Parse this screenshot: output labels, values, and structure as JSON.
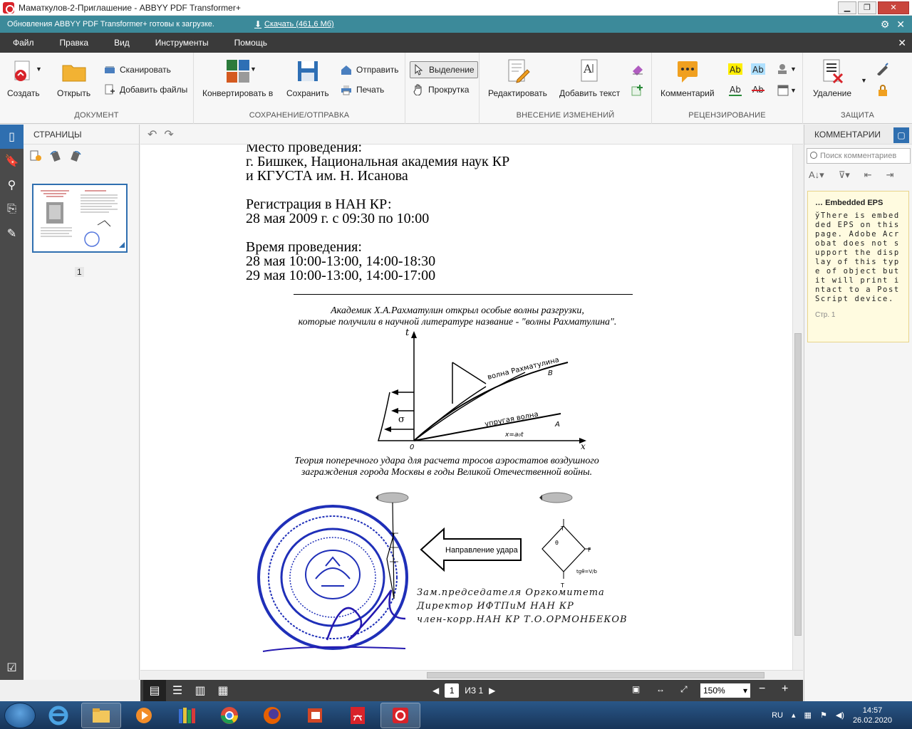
{
  "window": {
    "title": "Маматкулов-2-Приглашение - ABBYY PDF Transformer+"
  },
  "update_bar": {
    "message": "Обновления ABBYY PDF Transformer+ готовы к загрузке.",
    "download_label": "Скачать (461,6 Мб)"
  },
  "menu": [
    "Файл",
    "Правка",
    "Вид",
    "Инструменты",
    "Помощь"
  ],
  "ribbon": {
    "document": {
      "title": "ДОКУМЕНТ",
      "create": "Создать",
      "open": "Открыть",
      "scan": "Сканировать",
      "add_files": "Добавить файлы"
    },
    "save": {
      "title": "СОХРАНЕНИЕ/ОТПРАВКА",
      "convert": "Конвертировать в",
      "save": "Сохранить",
      "send": "Отправить",
      "print": "Печать",
      "select": "Выделение",
      "scroll": "Прокрутка"
    },
    "edit": {
      "title": "ВНЕСЕНИЕ ИЗМЕНЕНИЙ",
      "edit": "Редактировать",
      "add_text": "Добавить текст"
    },
    "review": {
      "title": "РЕЦЕНЗИРОВАНИЕ",
      "comment": "Комментарий"
    },
    "protect": {
      "title": "ЗАЩИТА",
      "delete": "Удаление"
    }
  },
  "pages_panel": {
    "title": "СТРАНИЦЫ",
    "page_number": "1"
  },
  "document": {
    "lines": [
      "Место проведения:",
      "г. Бишкек, Национальная академия наук КР",
      "и КГУСТА им. Н. Исанова",
      "Регистрация в НАН КР:",
      "28 мая 2009 г.  с 09:30 по 10:00",
      "Время проведения:",
      "28 мая 10:00-13:00, 14:00-18:30",
      "29 мая 10:00-13:00, 14:00-17:00"
    ],
    "caption1_line1": "Академик Х.А.Рахматулин открыл особые волны разгрузки,",
    "caption1_line2": "которые получили в научной  литературе  название - \"волны Рахматулина\".",
    "caption2_line1": "Теория поперечного удара для расчета тросов аэростатов воздушного",
    "caption2_line2": "заграждения города Москвы в годы Великой Отечественной войны.",
    "diagram": {
      "t_label": "t",
      "x_label": "x",
      "origin": "0",
      "sigma": "σ",
      "wave_r": "волна Рахматулина",
      "b_label": "B",
      "elastic": "упругая волна",
      "a_label": "A",
      "xeq": "x=a₀t"
    },
    "impact_label": "Направление удара",
    "force": {
      "T": "T",
      "F": "F",
      "theta": "θ",
      "formula": "tgθ=V/b"
    },
    "signature_lines": [
      "Зам.председателя Оргкомитета",
      "Директор ИФТПиМ НАН КР",
      "член-корр.НАН  КР   Т.О.ОРМОНБЕКОВ"
    ]
  },
  "bottom_bar": {
    "page_current": "1",
    "page_of": "ИЗ 1",
    "zoom": "150%"
  },
  "comments_panel": {
    "title": "КОММЕНТАРИИ",
    "search_placeholder": "Поиск комментариев",
    "card": {
      "header": "Embedded EPS",
      "body": "ўThere is embedded EPS on this page. Adobe Acrobat does not support the display of this type of object but it will print intact to a PostScript device.",
      "page": "Стр. 1"
    }
  },
  "taskbar": {
    "lang": "RU",
    "time": "14:57",
    "date": "26.02.2020"
  }
}
